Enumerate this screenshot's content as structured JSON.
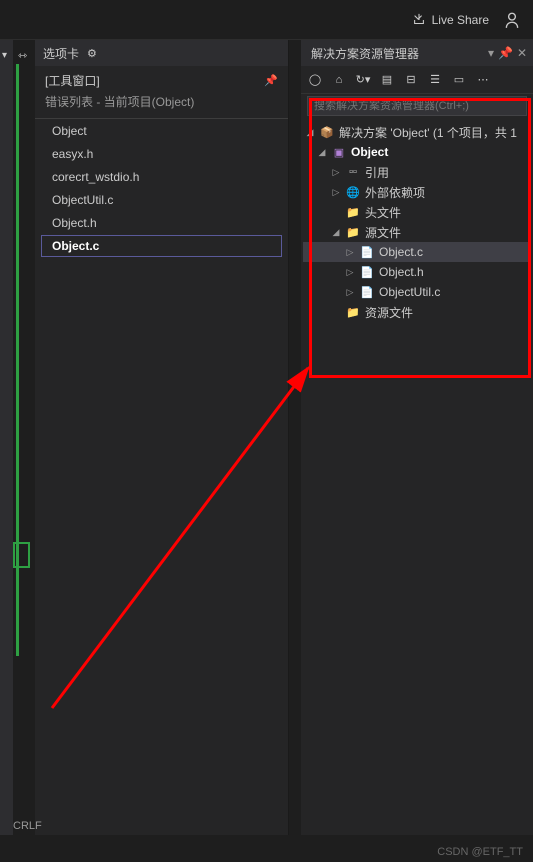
{
  "topbar": {
    "live_share": "Live Share"
  },
  "tabs_panel": {
    "title": "选项卡",
    "tool_window": "[工具窗口]",
    "subtitle": "错误列表 - 当前项目(Object)",
    "items": [
      "Object",
      "easyx.h",
      "corecrt_wstdio.h",
      "ObjectUtil.c",
      "Object.h",
      "Object.c"
    ],
    "selected_index": 5
  },
  "solution_panel": {
    "title": "解决方案资源管理器",
    "search_placeholder": "搜索解决方案资源管理器(Ctrl+;)",
    "root_label": "解决方案 'Object' (1 个项目，共 1",
    "nodes": [
      {
        "exp": "◢",
        "icon": "📦",
        "label": "解决方案 'Object' (1 个项目，共 1",
        "indent": 0,
        "ico_class": "ico-purple"
      },
      {
        "exp": "◢",
        "icon": "▣",
        "label": "Object",
        "indent": 1,
        "bold": true,
        "ico_class": "ico-purple"
      },
      {
        "exp": "▷",
        "icon": "▫▫",
        "label": "引用",
        "indent": 2
      },
      {
        "exp": "▷",
        "icon": "🌐",
        "label": "外部依赖项",
        "indent": 2,
        "ico_class": "ico-blue"
      },
      {
        "exp": "",
        "icon": "📁",
        "label": "头文件",
        "indent": 2,
        "ico_class": "ico-yellow"
      },
      {
        "exp": "◢",
        "icon": "📁",
        "label": "源文件",
        "indent": 2,
        "ico_class": "ico-yellow"
      },
      {
        "exp": "▷",
        "icon": "📄",
        "label": "Object.c",
        "indent": 3,
        "selected": true
      },
      {
        "exp": "▷",
        "icon": "📄",
        "label": "Object.h",
        "indent": 3
      },
      {
        "exp": "▷",
        "icon": "📄",
        "label": "ObjectUtil.c",
        "indent": 3
      },
      {
        "exp": "",
        "icon": "📁",
        "label": "资源文件",
        "indent": 2,
        "ico_class": "ico-yellow"
      }
    ]
  },
  "status": {
    "crlf": "CRLF"
  },
  "watermark": "CSDN @ETF_TT"
}
